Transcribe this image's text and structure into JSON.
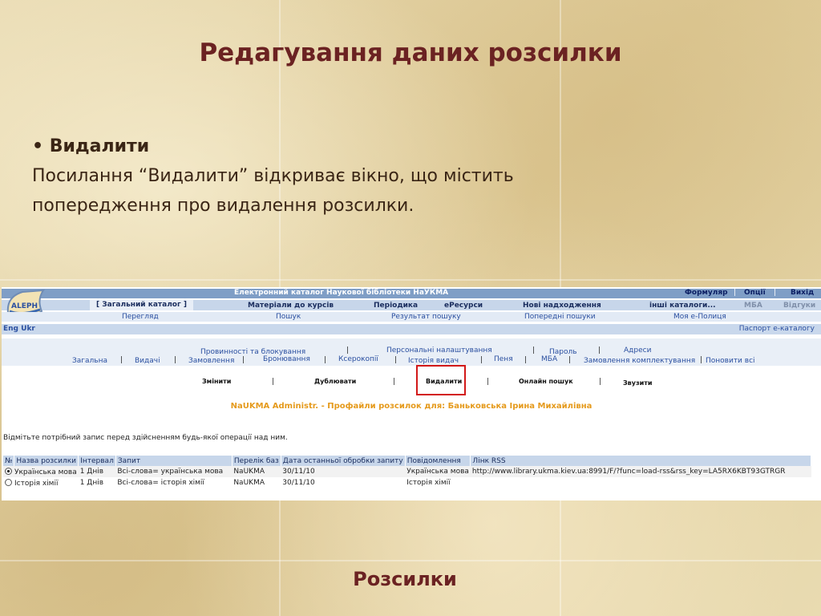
{
  "slide": {
    "title": "Редагування даних розсилки",
    "bullet_marker": "•",
    "bullet_heading": "Видалити",
    "bullet_text_line1": "Посилання “Видалити” відкриває вікно, що містить",
    "bullet_text_line2": "попередження про видалення розсилки.",
    "footer_title": "Розсилки"
  },
  "screenshot": {
    "logo_text": "ALEPH",
    "window_title": "Електронний каталог Наукової бібліотеки НаУКМА",
    "top_links": [
      "Формуляр",
      "Опції",
      "Вихід"
    ],
    "tabs": [
      "[ Загальний каталог ]",
      "Матеріали до курсів",
      "Періодика",
      "еРесурси",
      "Нові надходження",
      "інші каталоги...",
      "МБА",
      "Відгуки"
    ],
    "sub_links": [
      "Перегляд",
      "Пошук",
      "Результат пошуку",
      "Попередні пошуки",
      "Моя е-Полиця"
    ],
    "lang": "Eng Ukr",
    "passport_link": "Паспорт е-каталогу",
    "menu_row1": [
      "Провинності та блокування",
      "Персональні налаштування",
      "Пароль",
      "Адреси"
    ],
    "menu_row2": [
      "Загальна",
      "Видачі",
      "Замовлення",
      "Бронювання",
      "Ксерокопії",
      "Історія видач",
      "Пеня",
      "МБА",
      "Замовлення комплектування",
      "Поновити всі"
    ],
    "actions": [
      "Змінити",
      "Дублювати",
      "Видалити",
      "Онлайн пошук",
      "Звузити"
    ],
    "profile_title": "NaUKMA Administr. - Профайли розсилок для: Баньковська Ірина Михайлівна",
    "instruction": "Відмітьте потрібний запис перед здійсненням будь-якої операції над ним.",
    "table": {
      "headers": [
        "№",
        "Назва розсилки",
        "Інтервал",
        "Запит",
        "Перелік баз",
        "Дата останньої обробки запиту",
        "Повідомлення",
        "Лінк RSS"
      ],
      "rows": [
        {
          "selected": true,
          "name": "Українська мова",
          "interval": "1 Днів",
          "query": "Всі-слова= українська мова",
          "bases": "NaUKMA",
          "date": "30/11/10",
          "message": "Українська мова",
          "rss": "http://www.library.ukma.kiev.ua:8991/F/?func=load-rss&rss_key=LA5RX6KBT93GTRGR"
        },
        {
          "selected": false,
          "name": "Історія хімії",
          "interval": "1 Днів",
          "query": "Всі-слова= історія хімії",
          "bases": "NaUKMA",
          "date": "30/11/10",
          "message": "Історія хімії",
          "rss": ""
        }
      ]
    }
  },
  "colors": {
    "title": "#6b2222",
    "header_bar": "#7f9ec6",
    "highlight_box": "#d21818",
    "profile_title": "#e59a1c"
  }
}
